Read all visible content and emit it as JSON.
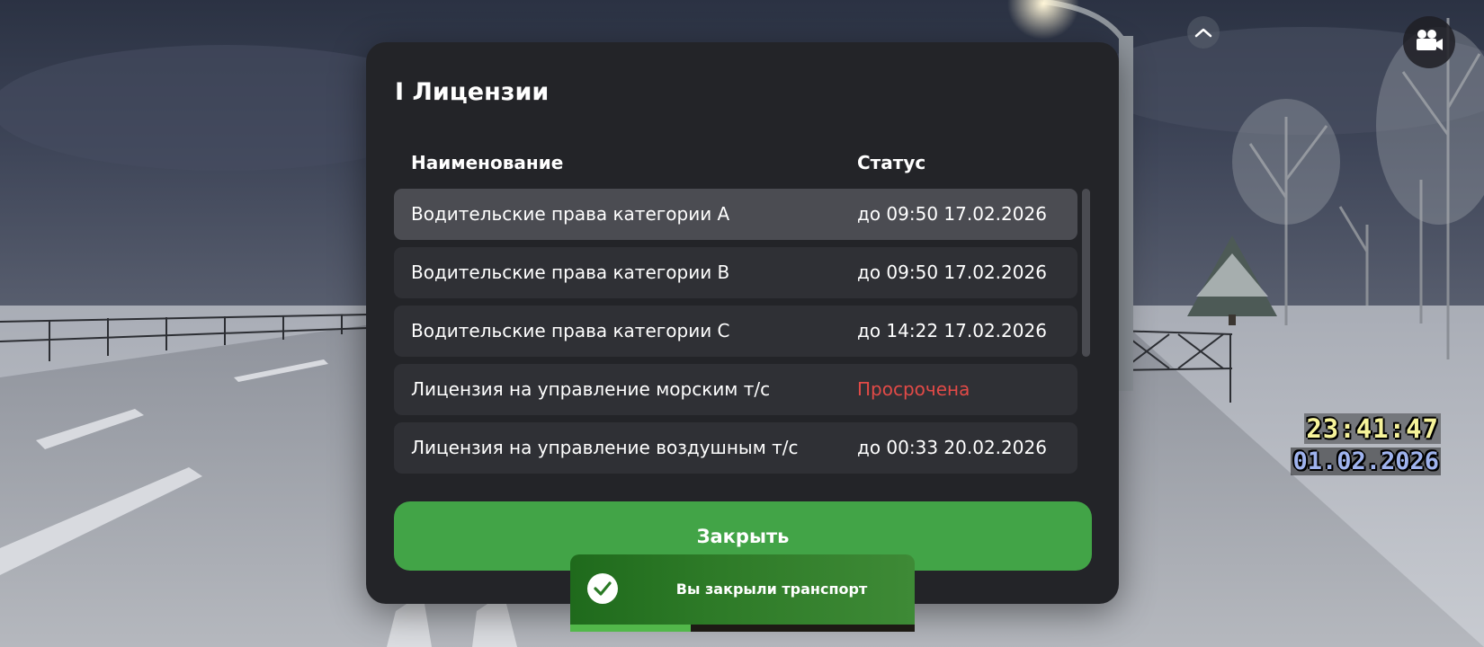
{
  "modal": {
    "title": "I Лицензии",
    "columns": {
      "name": "Наименование",
      "status": "Статус"
    },
    "rows": [
      {
        "name": "Водительские права категории A",
        "status": "до 09:50 17.02.2026",
        "expired": false,
        "selected": true
      },
      {
        "name": "Водительские права категории B",
        "status": "до 09:50 17.02.2026",
        "expired": false,
        "selected": false
      },
      {
        "name": "Водительские права категории C",
        "status": "до 14:22 17.02.2026",
        "expired": false,
        "selected": false
      },
      {
        "name": "Лицензия на управление морским т/с",
        "status": "Просрочена",
        "expired": true,
        "selected": false
      },
      {
        "name": "Лицензия на управление воздушным т/с",
        "status": "до 00:33 20.02.2026",
        "expired": false,
        "selected": false
      }
    ],
    "close_label": "Закрыть"
  },
  "hud": {
    "time": "23:41:47",
    "date": "01.02.2026"
  },
  "notification": {
    "text": "Вы закрыли транспорт",
    "progress": 0.35
  },
  "icons": {
    "collapse": "chevron-up-icon",
    "camera": "video-camera-icon",
    "toast": "check-icon"
  },
  "colors": {
    "modal_bg": "#232428",
    "row_bg": "#2f3035",
    "row_selected_bg": "#4b4c52",
    "close_button": "#42a447",
    "expired_text": "#e24a47",
    "hud_time": "#f6f39a",
    "hud_date": "#9fb3ee"
  }
}
